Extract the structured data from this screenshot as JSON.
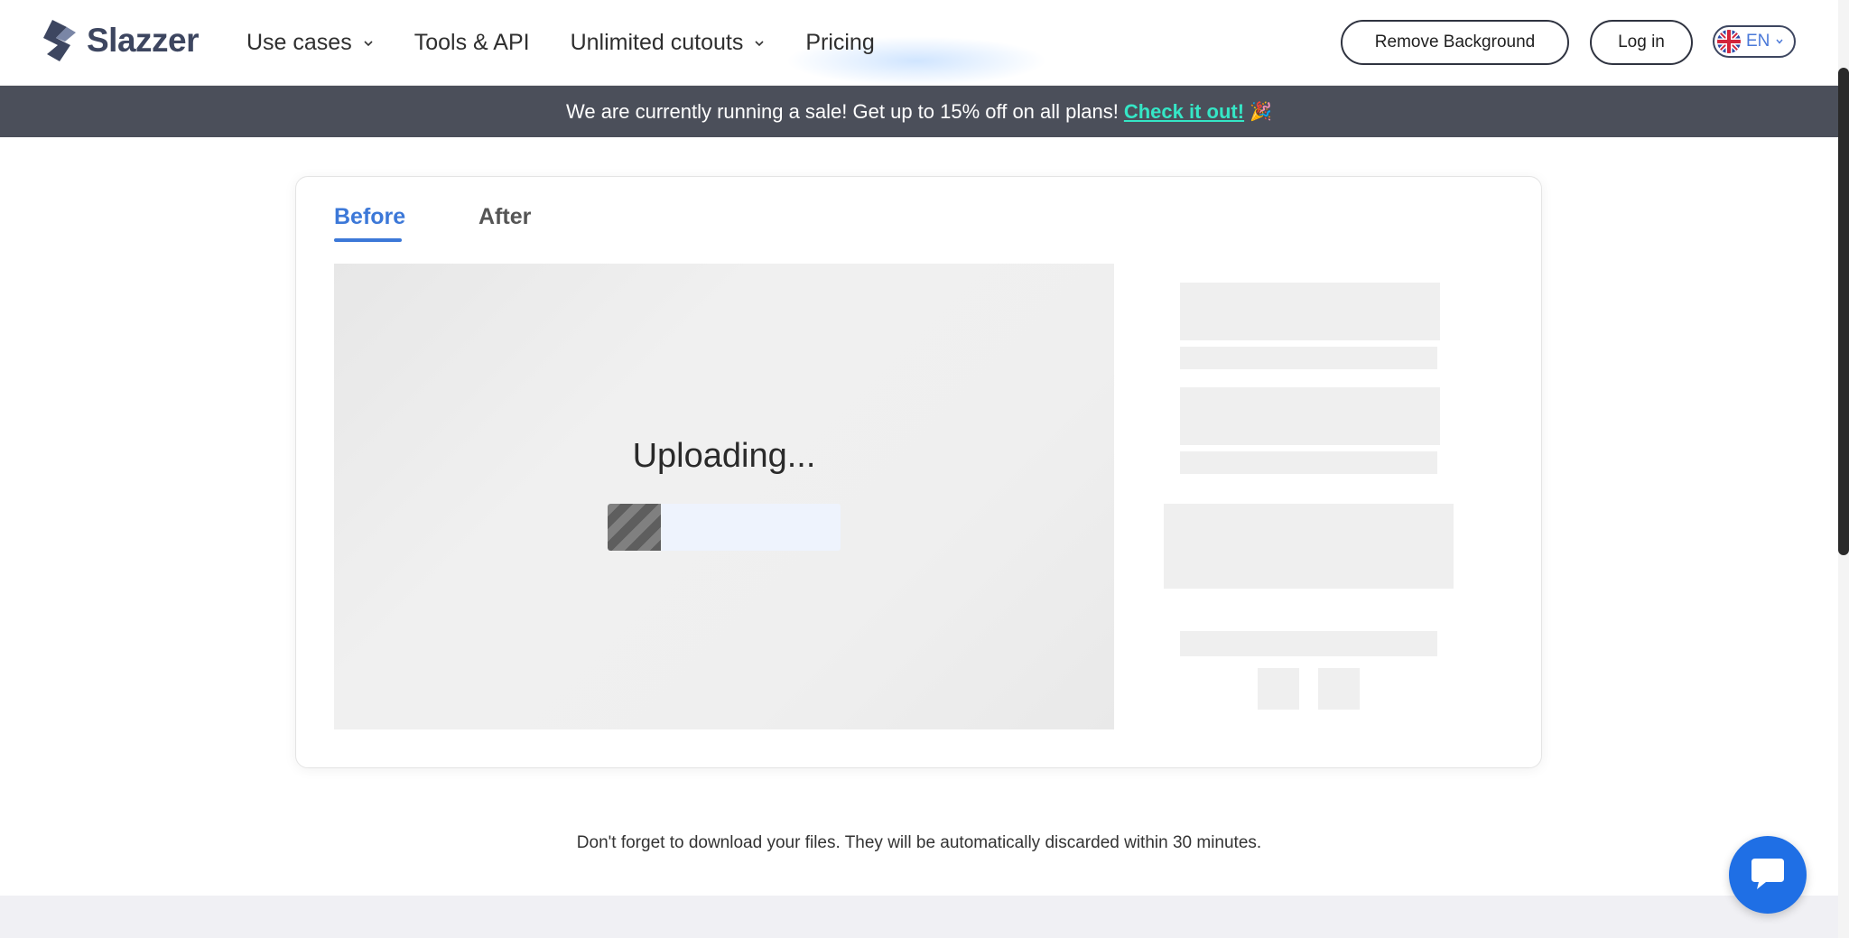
{
  "header": {
    "logo_text": "Slazzer",
    "nav": [
      {
        "label": "Use cases",
        "has_dropdown": true
      },
      {
        "label": "Tools & API",
        "has_dropdown": false
      },
      {
        "label": "Unlimited cutouts",
        "has_dropdown": true
      },
      {
        "label": "Pricing",
        "has_dropdown": false
      }
    ],
    "remove_background_label": "Remove Background",
    "login_label": "Log in",
    "language": "EN"
  },
  "banner": {
    "text": "We are currently running a sale! Get up to 15% off on all plans!",
    "link_text": "Check it out!",
    "emoji": "🎉"
  },
  "editor": {
    "tabs": [
      {
        "label": "Before",
        "active": true
      },
      {
        "label": "After",
        "active": false
      }
    ],
    "status_text": "Uploading...",
    "progress_fraction": 0.23
  },
  "footer_note": "Don't forget to download your files. They will be automatically discarded within 30 minutes.",
  "colors": {
    "accent": "#3c78d8",
    "banner_bg": "#4b4f5a",
    "banner_link": "#35e6c6",
    "chat_button": "#1f6fe5"
  },
  "icons": {
    "logo": "slazzer-logo-icon",
    "chevron": "chevron-down-icon",
    "flag": "uk-flag-icon",
    "chat": "chat-bubble-icon"
  }
}
